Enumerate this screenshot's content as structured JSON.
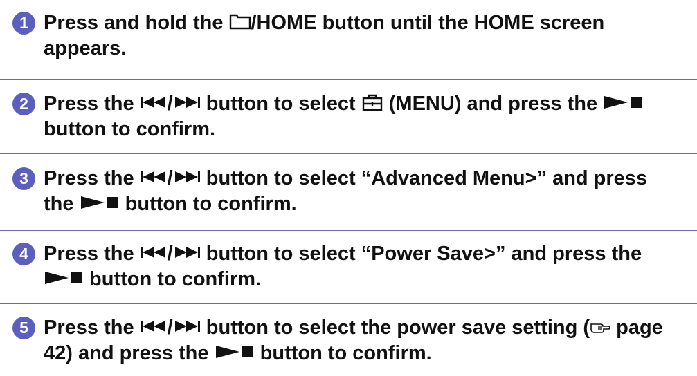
{
  "colors": {
    "accent": "#5d5fbf",
    "divider": "#6a6ab8",
    "text": "#111111"
  },
  "icons": {
    "home": "folder-home-icon",
    "prev_next": "prev-next-track-icon",
    "menu": "toolbox-menu-icon",
    "play_stop": "play-stop-icon",
    "page_ref": "pointing-hand-icon"
  },
  "steps": [
    {
      "number": "1",
      "t1": "Press and hold the ",
      "t2": "/HOME button until the HOME screen appears."
    },
    {
      "number": "2",
      "t1": "Press the ",
      "t2": "/",
      "t3": " button to select ",
      "t4": " (MENU) and press the ",
      "t5": " button to confirm."
    },
    {
      "number": "3",
      "t1": "Press the ",
      "t2": "/",
      "t3": " button to select “Advanced Menu>” and press the ",
      "t4": " button to confirm."
    },
    {
      "number": "4",
      "t1": "Press the ",
      "t2": "/",
      "t3": " button to select “Power Save>” and press the ",
      "t4": " button to confirm."
    },
    {
      "number": "5",
      "t1": "Press the ",
      "t2": "/",
      "t3": " button to select the power save setting (",
      "t4": " page 42) and press the ",
      "t5": " button to confirm."
    }
  ]
}
